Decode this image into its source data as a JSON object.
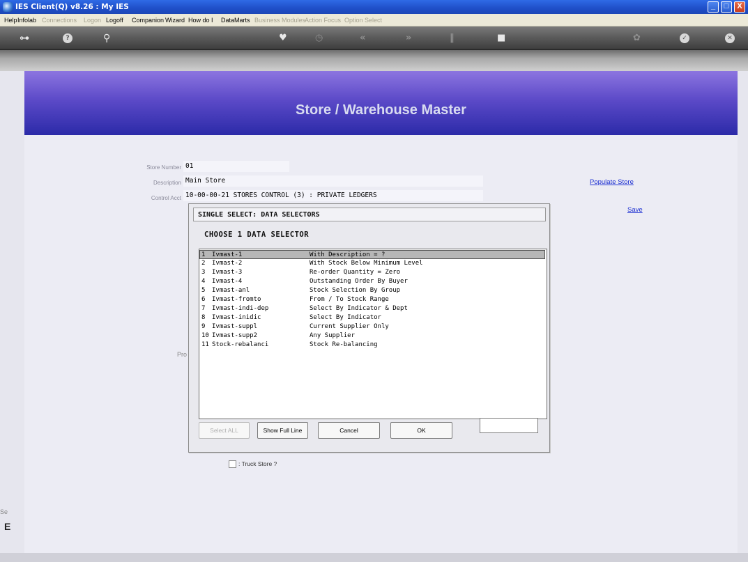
{
  "window": {
    "title": "IES Client(Q) v8.26 : My IES",
    "min": "_",
    "max": "□",
    "close": "X"
  },
  "menu": {
    "items": [
      {
        "label": "Help",
        "enabled": true
      },
      {
        "label": "Infolab",
        "enabled": true
      },
      {
        "label": "Connections",
        "enabled": false
      },
      {
        "label": "Logon",
        "enabled": false
      },
      {
        "label": "Logoff",
        "enabled": true
      },
      {
        "label": "Companion",
        "enabled": true
      },
      {
        "label": "Wizard",
        "enabled": true
      },
      {
        "label": "How do I",
        "enabled": true
      },
      {
        "label": "DataMarts",
        "enabled": true
      },
      {
        "label": "Business Modules",
        "enabled": false
      },
      {
        "label": "Action Focus",
        "enabled": false
      },
      {
        "label": "Option Select",
        "enabled": false
      }
    ]
  },
  "toolbar": {
    "icons": [
      "key-icon",
      "help-icon",
      "search-icon",
      "heart-icon",
      "clock-icon",
      "rewind-icon",
      "fast-forward-icon",
      "pause-icon",
      "stop-icon",
      "settings-icon",
      "check-icon",
      "close-icon"
    ]
  },
  "banner": {
    "heading": "Store / Warehouse Master"
  },
  "form": {
    "store_number_label": "Store Number",
    "store_number": "01",
    "description_label": "Description",
    "description": "Main Store",
    "control_acct_label": "Control Acct",
    "control_acct": "10-00-00-21 STORES CONTROL (3) : PRIVATE LEDGERS",
    "populate_store": "Populate Store",
    "save": "Save",
    "truck_store_label": ": Truck Store ?",
    "partial_pro": "Pro",
    "partial_se": "Se",
    "partial_e": "E"
  },
  "dialog": {
    "title": "SINGLE SELECT: DATA SELECTORS",
    "heading": "CHOOSE 1 DATA SELECTOR",
    "rows": [
      {
        "num": "1",
        "name": "Ivmast-1",
        "desc": "With Description = ?"
      },
      {
        "num": "2",
        "name": "Ivmast-2",
        "desc": "With Stock Below Minimum Level"
      },
      {
        "num": "3",
        "name": "Ivmast-3",
        "desc": "Re-order Quantity = Zero"
      },
      {
        "num": "4",
        "name": "Ivmast-4",
        "desc": "Outstanding Order By Buyer"
      },
      {
        "num": "5",
        "name": "Ivmast-anl",
        "desc": "Stock Selection By Group"
      },
      {
        "num": "6",
        "name": "Ivmast-fromto",
        "desc": "From / To Stock Range"
      },
      {
        "num": "7",
        "name": "Ivmast-indi-dep",
        "desc": "Select By Indicator & Dept"
      },
      {
        "num": "8",
        "name": "Ivmast-inidic",
        "desc": "Select By Indicator"
      },
      {
        "num": "9",
        "name": "Ivmast-suppl",
        "desc": "Current Supplier Only"
      },
      {
        "num": "10",
        "name": "Ivmast-supp2",
        "desc": "Any Supplier"
      },
      {
        "num": "11",
        "name": "Stock-rebalanci",
        "desc": "Stock Re-balancing"
      }
    ],
    "selected_index": 0,
    "buttons": {
      "select_all": "Select ALL",
      "show_full_line": "Show Full Line",
      "cancel": "Cancel",
      "ok": "OK"
    },
    "input_value": ""
  }
}
